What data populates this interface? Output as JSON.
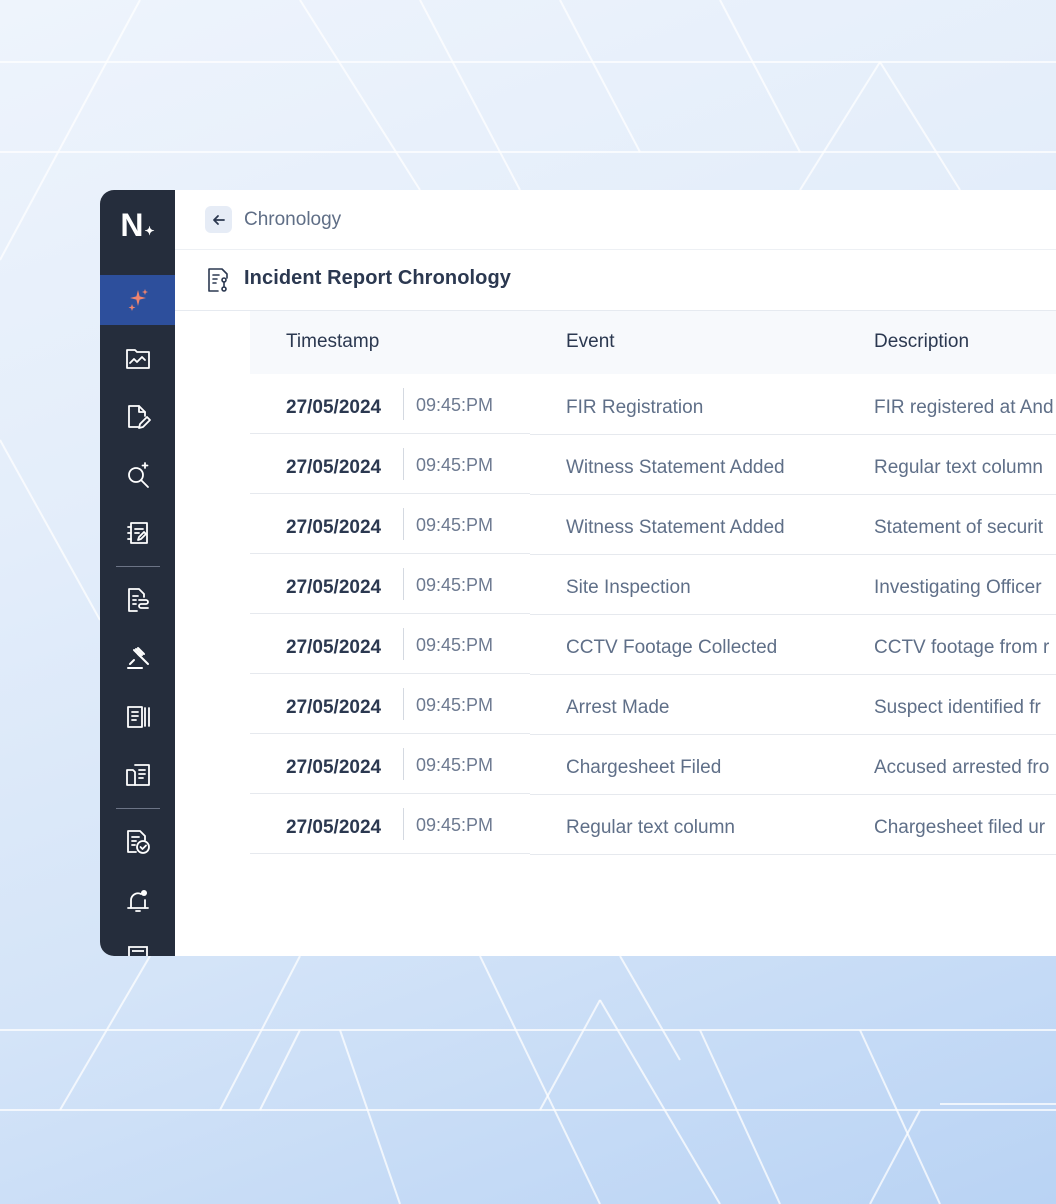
{
  "app": {
    "logo_text": "N",
    "logo_mark": "✦"
  },
  "breadcrumb": {
    "back_icon": "arrow-left-icon",
    "label": "Chronology"
  },
  "page": {
    "title": "Incident Report Chronology",
    "title_icon": "document-flow-icon"
  },
  "sidebar": {
    "items": [
      {
        "id": "ai",
        "icon": "sparkles-icon",
        "active": true
      },
      {
        "id": "analytics",
        "icon": "document-chart-icon"
      },
      {
        "id": "edit",
        "icon": "document-edit-icon"
      },
      {
        "id": "search",
        "icon": "search-sparkle-icon"
      },
      {
        "id": "notes",
        "icon": "notebook-icon"
      },
      {
        "id": "flow",
        "icon": "document-flow-icon"
      },
      {
        "id": "legal",
        "icon": "gavel-icon"
      },
      {
        "id": "records",
        "icon": "document-lines-icon"
      },
      {
        "id": "files",
        "icon": "folder-document-icon"
      },
      {
        "id": "review",
        "icon": "document-check-icon"
      },
      {
        "id": "alerts",
        "icon": "bell-badge-icon"
      }
    ],
    "colors": {
      "background": "#252d3c",
      "active": "#2d4f9c",
      "accent": "#f0846e"
    }
  },
  "table": {
    "columns": [
      "Timestamp",
      "Event",
      "Description"
    ],
    "rows": [
      {
        "date": "27/05/2024",
        "time": "09:45:PM",
        "event": "FIR Registration",
        "description": "FIR registered at And"
      },
      {
        "date": "27/05/2024",
        "time": "09:45:PM",
        "event": "Witness Statement Added",
        "description": "Regular text column"
      },
      {
        "date": "27/05/2024",
        "time": "09:45:PM",
        "event": "Witness Statement Added",
        "description": "Statement of securit"
      },
      {
        "date": "27/05/2024",
        "time": "09:45:PM",
        "event": "Site Inspection",
        "description": "Investigating Officer"
      },
      {
        "date": "27/05/2024",
        "time": "09:45:PM",
        "event": "CCTV Footage Collected",
        "description": "CCTV footage from r"
      },
      {
        "date": "27/05/2024",
        "time": "09:45:PM",
        "event": "Arrest Made",
        "description": "Suspect identified fr"
      },
      {
        "date": "27/05/2024",
        "time": "09:45:PM",
        "event": "Chargesheet Filed",
        "description": "Accused arrested fro"
      },
      {
        "date": "27/05/2024",
        "time": "09:45:PM",
        "event": "Regular text column",
        "description": "Chargesheet filed ur"
      }
    ]
  }
}
